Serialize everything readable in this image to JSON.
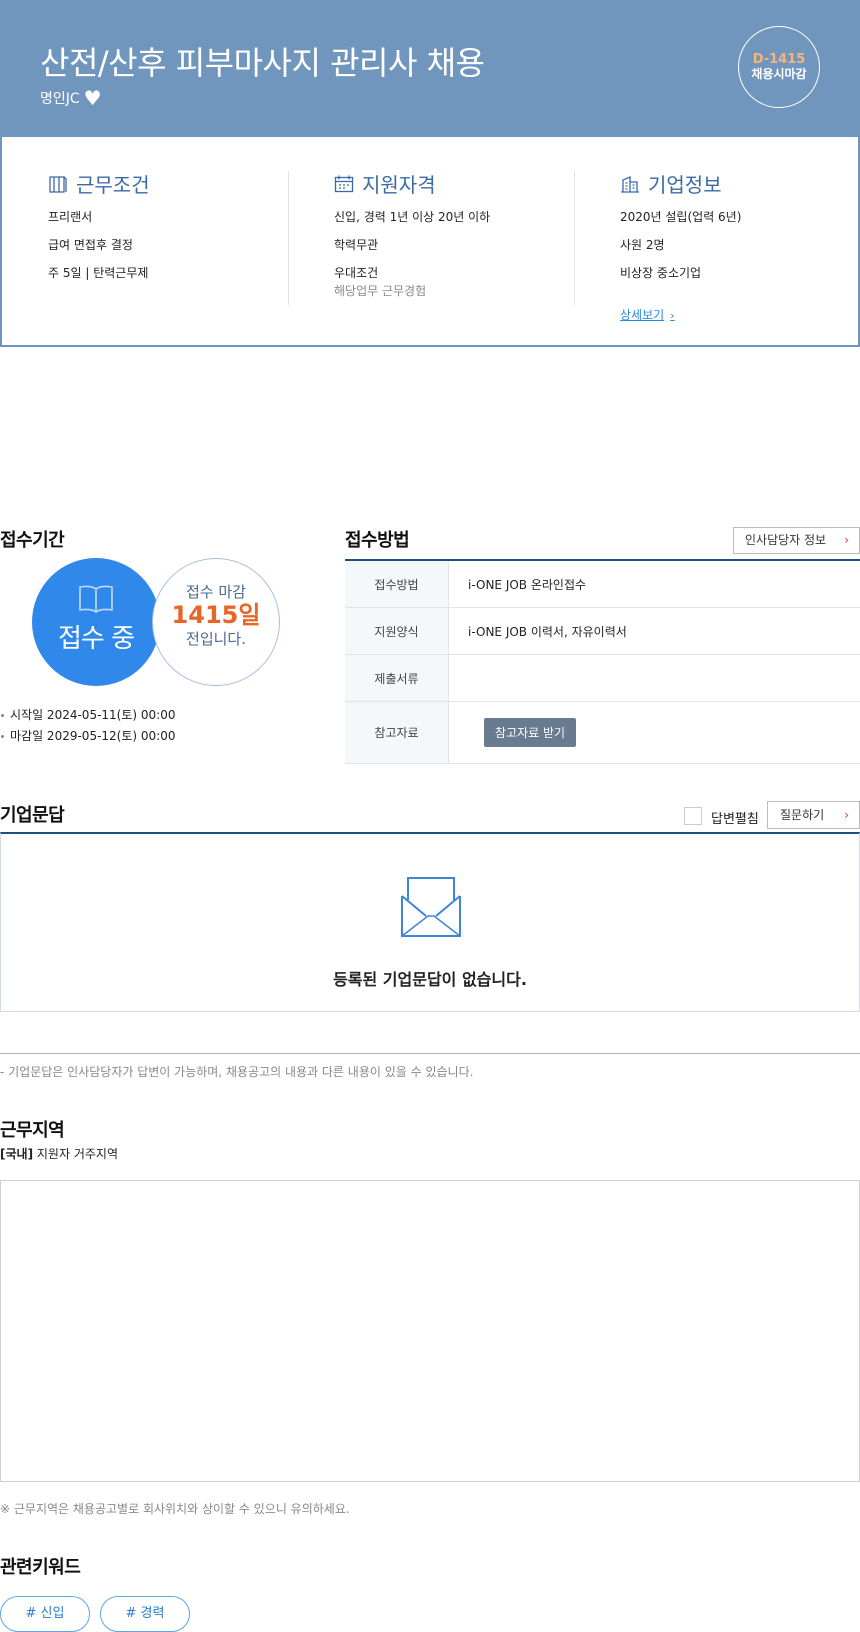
{
  "header": {
    "title": "산전/산후 피부마사지 관리사 채용",
    "company": "명인JC",
    "dday": "D-1415",
    "dday_label": "채용시마감",
    "colors": {
      "header_bg": "#7196be",
      "dday_text": "#f5b679"
    }
  },
  "summary": {
    "conditions": {
      "title": "근무조건",
      "lines": [
        "프리랜서",
        "급여 면접후 결정",
        "주 5일 | 탄력근무제"
      ]
    },
    "qualifications": {
      "title": "지원자격",
      "lines": [
        "신입, 경력 1년 이상 20년 이하",
        "학력무관",
        "우대조건"
      ],
      "sub": "해당업무 근무경험"
    },
    "company_info": {
      "title": "기업정보",
      "lines": [
        "2020년 설립(업력 6년)",
        "사원 2명",
        "비상장 중소기업"
      ],
      "more": "상세보기"
    }
  },
  "period": {
    "title": "접수기간",
    "status": "접수 중",
    "deadline_top": "접수 마감",
    "deadline_days": "1415일",
    "deadline_bottom": "전입니다.",
    "start": "시작일 2024-05-11(토) 00:00",
    "end": "마감일 2029-05-12(토) 00:00"
  },
  "method": {
    "title": "접수방법",
    "hr_button": "인사담당자 정보",
    "rows": [
      {
        "key": "접수방법",
        "value": "i-ONE JOB 온라인접수"
      },
      {
        "key": "지원양식",
        "value": "i-ONE JOB 이력서, 자유이력서"
      },
      {
        "key": "제출서류",
        "value": ""
      },
      {
        "key": "참고자료",
        "button": "참고자료 받기"
      }
    ]
  },
  "qa": {
    "title": "기업문답",
    "toggle_label": "답변펼침",
    "ask_button": "질문하기",
    "empty": "등록된 기업문답이 없습니다.",
    "note": "- 기업문답은 인사담당자가 답변이 가능하며, 채용공고의 내용과 다른 내용이 있을 수 있습니다."
  },
  "region": {
    "title": "근무지역",
    "tag": "[국내]",
    "value": "지원자 거주지역",
    "note": "※ 근무지역은 채용공고별로 회사위치와 상이할 수 있으니 유의하세요."
  },
  "keywords": {
    "title": "관련키워드",
    "items": [
      "# 신입",
      "# 경력"
    ]
  }
}
